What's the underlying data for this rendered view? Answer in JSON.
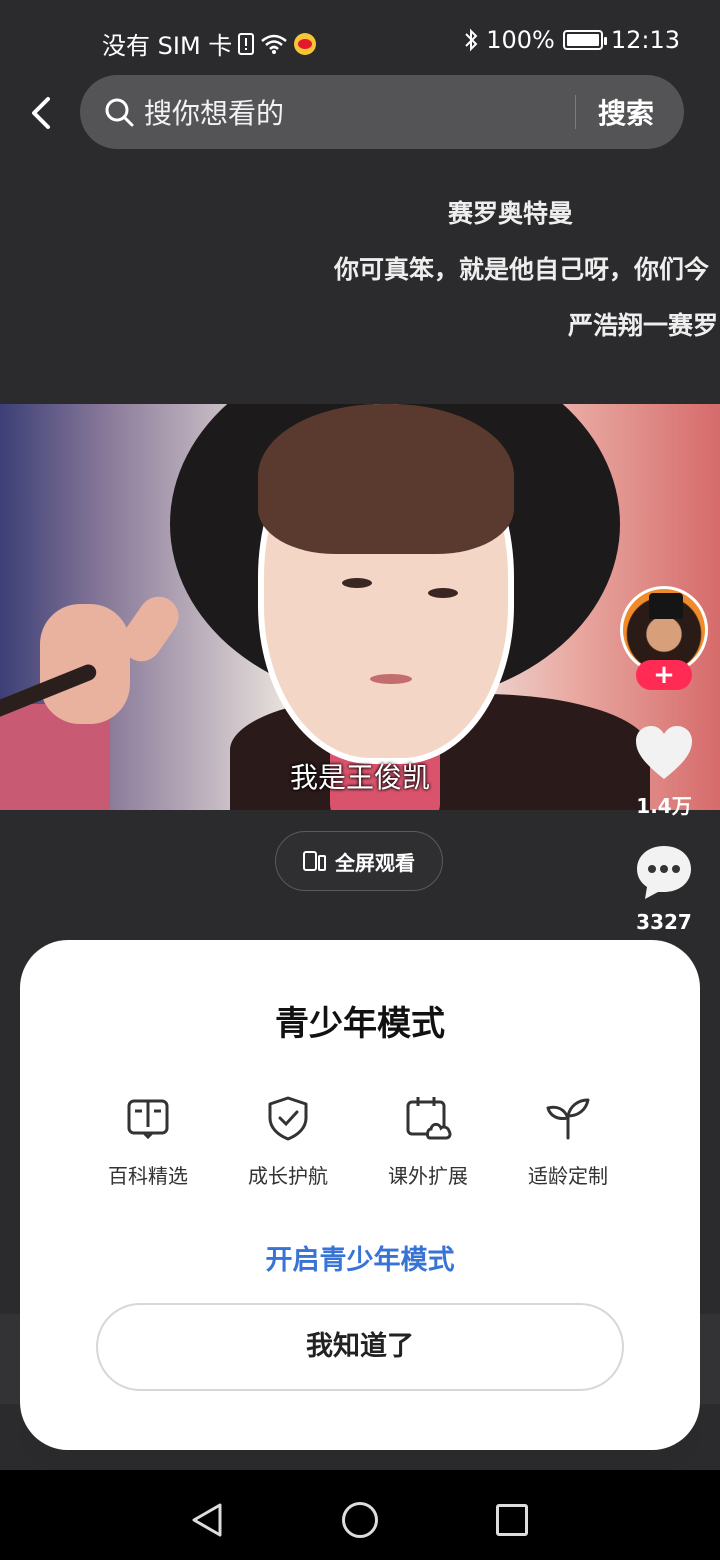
{
  "status_bar": {
    "carrier": "没有 SIM 卡",
    "battery": "100%",
    "battery_level": 1.0,
    "time": "12:13"
  },
  "search": {
    "placeholder": "搜你想看的",
    "button": "搜索"
  },
  "lyrics": [
    "赛罗奥特曼",
    "你可真笨，就是他自己呀，你们今",
    "严浩翔一赛罗"
  ],
  "video": {
    "caption": "我是王俊凯",
    "fullscreen_label": "全屏观看"
  },
  "side_actions": {
    "follow": "+",
    "likes": "1.4万",
    "comments": "3327"
  },
  "dialog": {
    "title": "青少年模式",
    "features": [
      {
        "icon": "book-icon",
        "label": "百科精选"
      },
      {
        "icon": "shield-check-icon",
        "label": "成长护航"
      },
      {
        "icon": "calendar-cloud-icon",
        "label": "课外扩展"
      },
      {
        "icon": "sprout-icon",
        "label": "适龄定制"
      }
    ],
    "enable_link": "开启青少年模式",
    "dismiss_button": "我知道了"
  },
  "colors": {
    "accent_blue": "#3873d6",
    "follow_red": "#ff2b55",
    "background": "#2b2b2d"
  }
}
